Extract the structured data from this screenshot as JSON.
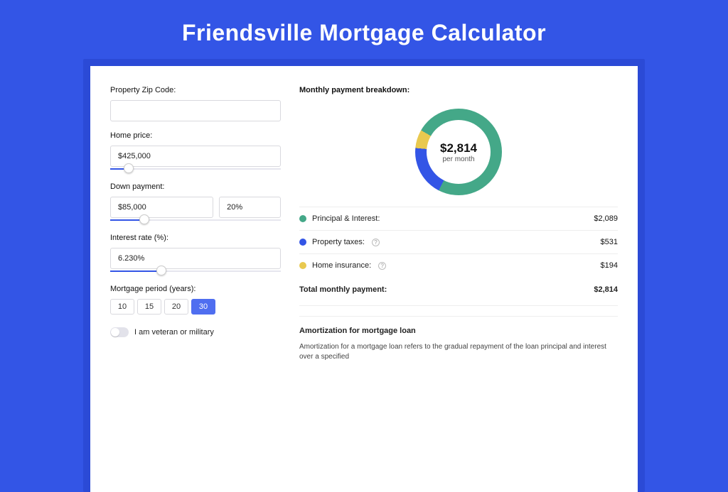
{
  "title": "Friendsville Mortgage Calculator",
  "form": {
    "zip_label": "Property Zip Code:",
    "zip_value": "",
    "home_price_label": "Home price:",
    "home_price_value": "$425,000",
    "home_price_slider_pct": 11,
    "down_payment_label": "Down payment:",
    "down_payment_value": "$85,000",
    "down_payment_pct_value": "20%",
    "down_payment_slider_pct": 20,
    "interest_label": "Interest rate (%):",
    "interest_value": "6.230%",
    "interest_slider_pct": 30,
    "period_label": "Mortgage period (years):",
    "periods": [
      "10",
      "15",
      "20",
      "30"
    ],
    "period_active_index": 3,
    "veteran_label": "I am veteran or military"
  },
  "breakdown": {
    "heading": "Monthly payment breakdown:",
    "center_amount": "$2,814",
    "center_sub": "per month",
    "rows": [
      {
        "color": "green",
        "label": "Principal & Interest:",
        "value": "$2,089",
        "help": false
      },
      {
        "color": "blue",
        "label": "Property taxes:",
        "value": "$531",
        "help": true
      },
      {
        "color": "yellow",
        "label": "Home insurance:",
        "value": "$194",
        "help": true
      }
    ],
    "total_label": "Total monthly payment:",
    "total_value": "$2,814"
  },
  "chart_data": {
    "type": "pie",
    "title": "Monthly payment breakdown",
    "series": [
      {
        "name": "Principal & Interest",
        "value": 2089,
        "color": "#44a888"
      },
      {
        "name": "Property taxes",
        "value": 531,
        "color": "#3355e6"
      },
      {
        "name": "Home insurance",
        "value": 194,
        "color": "#e9c94f"
      }
    ],
    "total": 2814,
    "center_label": "$2,814 per month"
  },
  "amortization": {
    "heading": "Amortization for mortgage loan",
    "text": "Amortization for a mortgage loan refers to the gradual repayment of the loan principal and interest over a specified"
  }
}
